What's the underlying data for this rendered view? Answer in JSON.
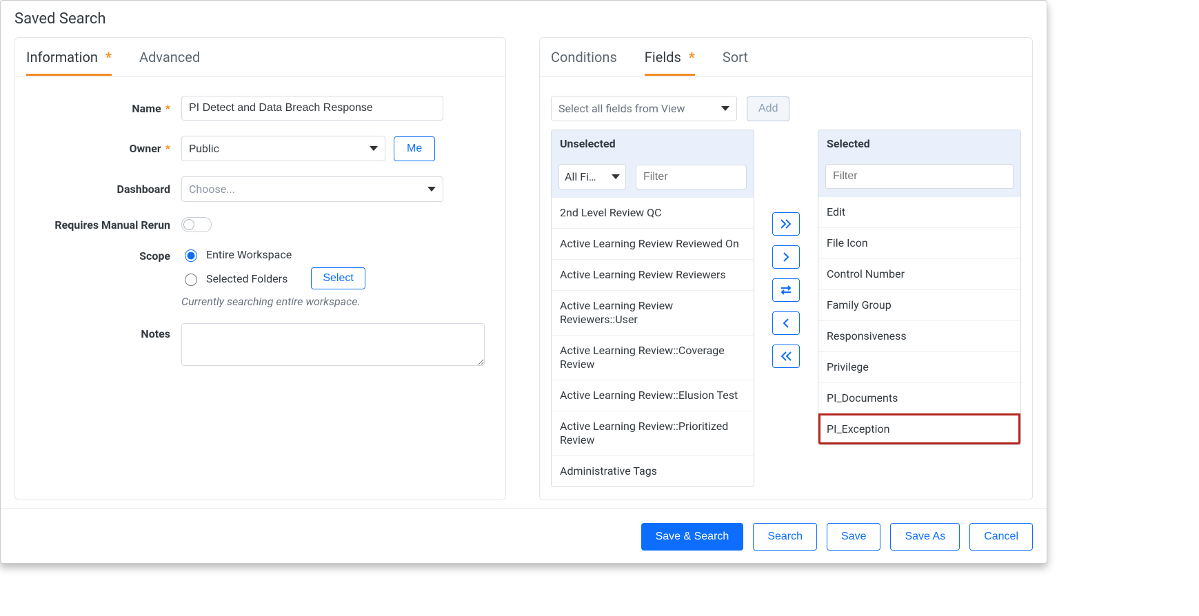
{
  "title": "Saved Search",
  "left": {
    "tabs": [
      "Information",
      "Advanced"
    ],
    "active_tab": 0,
    "labels": {
      "name": "Name",
      "owner": "Owner",
      "dashboard": "Dashboard",
      "requires_rerun": "Requires Manual Rerun",
      "scope": "Scope",
      "notes": "Notes"
    },
    "values": {
      "name": "PI Detect and Data Breach Response",
      "owner_selected": "Public",
      "me_button": "Me",
      "dashboard_placeholder": "Choose...",
      "requires_rerun": false,
      "scope_selected": "entire",
      "scope_options": [
        "Entire Workspace",
        "Selected Folders"
      ],
      "select_button": "Select",
      "scope_hint": "Currently searching entire workspace.",
      "notes": ""
    }
  },
  "right": {
    "tabs": [
      "Conditions",
      "Fields",
      "Sort"
    ],
    "active_tab": 1,
    "view_select_placeholder": "Select all fields from View",
    "add_button": "Add",
    "unselected": {
      "header": "Unselected",
      "filter_select_selected": "All Fi…",
      "filter_input_placeholder": "Filter",
      "items": [
        "2nd Level Review QC",
        "Active Learning Review Reviewed On",
        "Active Learning Review Reviewers",
        "Active Learning Review Reviewers::User",
        "Active Learning Review::Coverage Review",
        "Active Learning Review::Elusion Test",
        "Active Learning Review::Prioritized Review",
        "Administrative Tags"
      ]
    },
    "selected": {
      "header": "Selected",
      "filter_input_placeholder": "Filter",
      "items": [
        "Edit",
        "File Icon",
        "Control Number",
        "Family Group",
        "Responsiveness",
        "Privilege",
        "PI_Documents",
        "PI_Exception"
      ],
      "highlight_index": 7
    }
  },
  "footer": {
    "save_search": "Save & Search",
    "search": "Search",
    "save": "Save",
    "save_as": "Save As",
    "cancel": "Cancel"
  }
}
